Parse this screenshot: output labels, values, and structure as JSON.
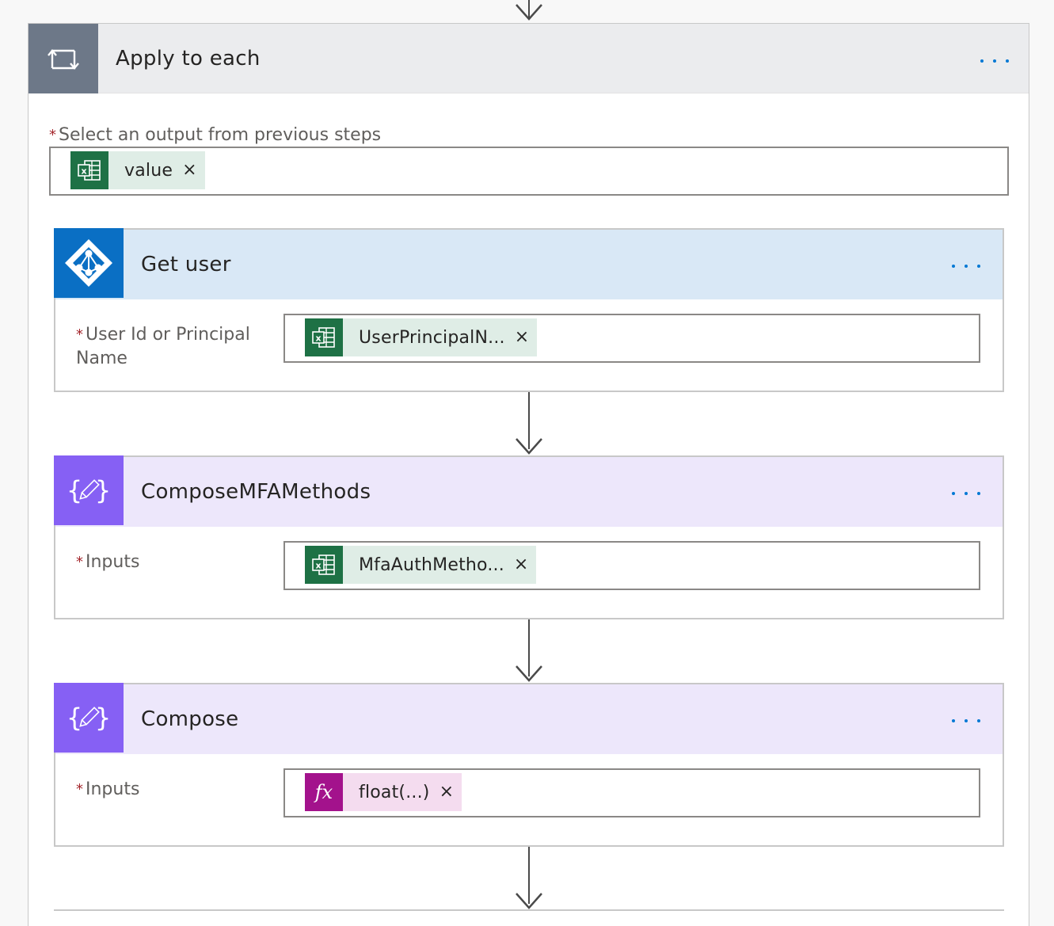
{
  "colors": {
    "apply_header": "#ebecee",
    "apply_icon": "#6d7888",
    "azure_header": "#d9e8f6",
    "azure_icon": "#0a6fc4",
    "compose_header": "#ede7fb",
    "compose_icon": "#8660f4",
    "excel_icon": "#1e7145",
    "excel_token_bg": "#dfede6",
    "expression_icon": "#a3128c",
    "expression_token_bg": "#f4dcef",
    "ellipsis": "#0078d4",
    "required_star": "#a4262c"
  },
  "apply_to_each": {
    "title": "Apply to each",
    "icon": "loop-icon",
    "field_label": "Select an output from previous steps",
    "required_mark": "*",
    "token": {
      "label": "value",
      "icon": "excel-icon",
      "remove": "×"
    }
  },
  "actions": [
    {
      "title": "Get user",
      "icon": "azure-ad-icon",
      "field_label": "User Id or Principal Name",
      "required_mark": "*",
      "token": {
        "label": "UserPrincipalN...",
        "icon": "excel-icon",
        "remove": "×"
      }
    },
    {
      "title": "ComposeMFAMethods",
      "icon": "compose-icon",
      "field_label": "Inputs",
      "required_mark": "*",
      "token": {
        "label": "MfaAuthMetho...",
        "icon": "excel-icon",
        "remove": "×"
      }
    },
    {
      "title": "Compose",
      "icon": "compose-icon",
      "field_label": "Inputs",
      "required_mark": "*",
      "token": {
        "label": "float(...)",
        "icon": "expression-icon",
        "icon_text": "fx",
        "remove": "×"
      }
    }
  ]
}
